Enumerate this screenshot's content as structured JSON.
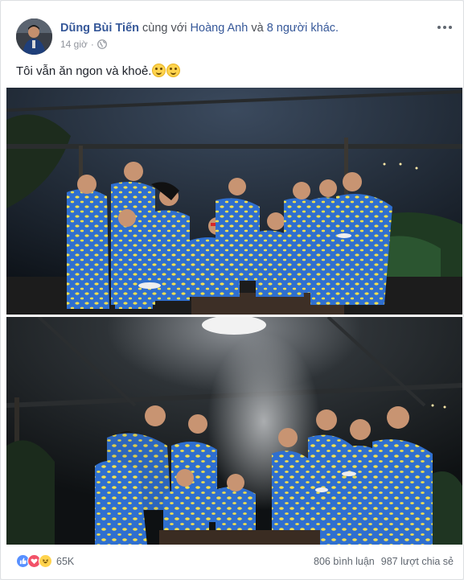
{
  "post": {
    "author": "Dũng Bùi Tiến",
    "with_text": "cùng với",
    "tagged_person": "Hoàng Anh",
    "and_text": "và",
    "others_link": "8 người khác.",
    "time": "14 giờ",
    "privacy_icon": "globe-icon",
    "caption": "Tôi vẫn ăn ngon và khoẻ.",
    "caption_emojis": [
      "smiling-face-emoji",
      "smiling-face-emoji"
    ]
  },
  "footer": {
    "reaction_icons": [
      "like-icon",
      "love-icon",
      "haha-icon"
    ],
    "reaction_count": "65K",
    "comments": "806 bình luận",
    "shares": "987 lượt chia sẻ"
  },
  "colors": {
    "link": "#365899",
    "muted": "#90949c",
    "shirt": "#2f6fcf",
    "pattern": "#f4e04d"
  }
}
